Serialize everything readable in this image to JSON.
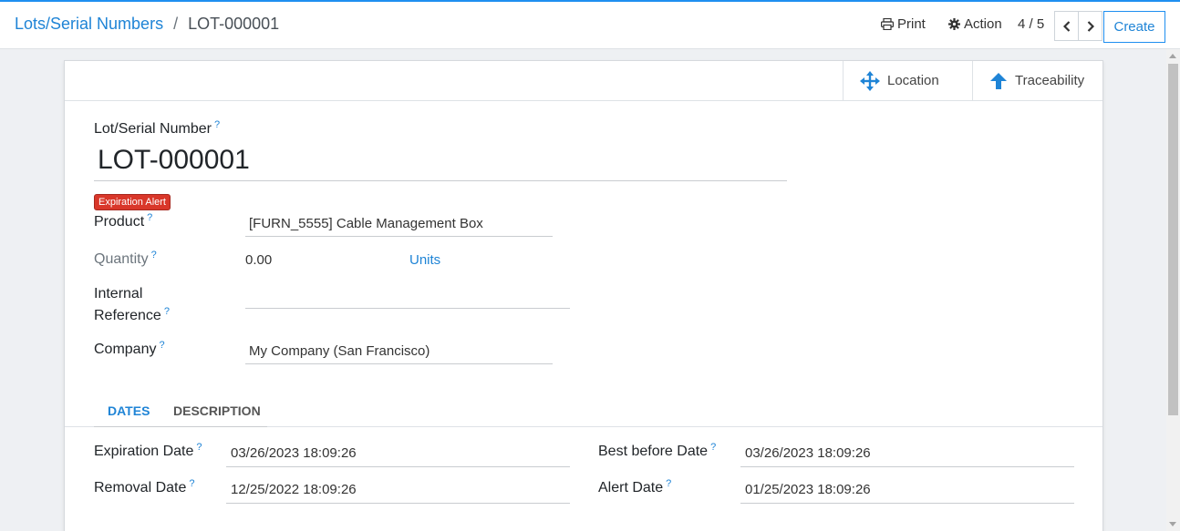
{
  "breadcrumb": {
    "parent": "Lots/Serial Numbers",
    "separator": "/",
    "current": "LOT-000001"
  },
  "toolbar": {
    "print_label": "Print",
    "action_label": "Action",
    "pager": "4 / 5",
    "create_label": "Create"
  },
  "smart_buttons": {
    "location_label": "Location",
    "traceability_label": "Traceability"
  },
  "form": {
    "name_label": "Lot/Serial Number",
    "name_value": "LOT-000001",
    "badge": "Expiration Alert",
    "help_mark": "?",
    "product_label": "Product",
    "product_value": "[FURN_5555] Cable Management Box",
    "quantity_label": "Quantity",
    "quantity_value": "0.00",
    "quantity_uom": "Units",
    "internal_ref_label_line1": "Internal",
    "internal_ref_label_line2": "Reference",
    "internal_ref_value": "",
    "company_label": "Company",
    "company_value": "My Company (San Francisco)"
  },
  "tabs": [
    {
      "label": "DATES",
      "active": true
    },
    {
      "label": "DESCRIPTION",
      "active": false
    }
  ],
  "dates": {
    "expiration_label": "Expiration Date",
    "expiration_value": "03/26/2023 18:09:26",
    "removal_label": "Removal Date",
    "removal_value": "12/25/2022 18:09:26",
    "best_before_label": "Best before Date",
    "best_before_value": "03/26/2023 18:09:26",
    "alert_label": "Alert Date",
    "alert_value": "01/25/2023 18:09:26"
  },
  "colors": {
    "accent": "#1f84d6",
    "badge": "#d9372a"
  }
}
